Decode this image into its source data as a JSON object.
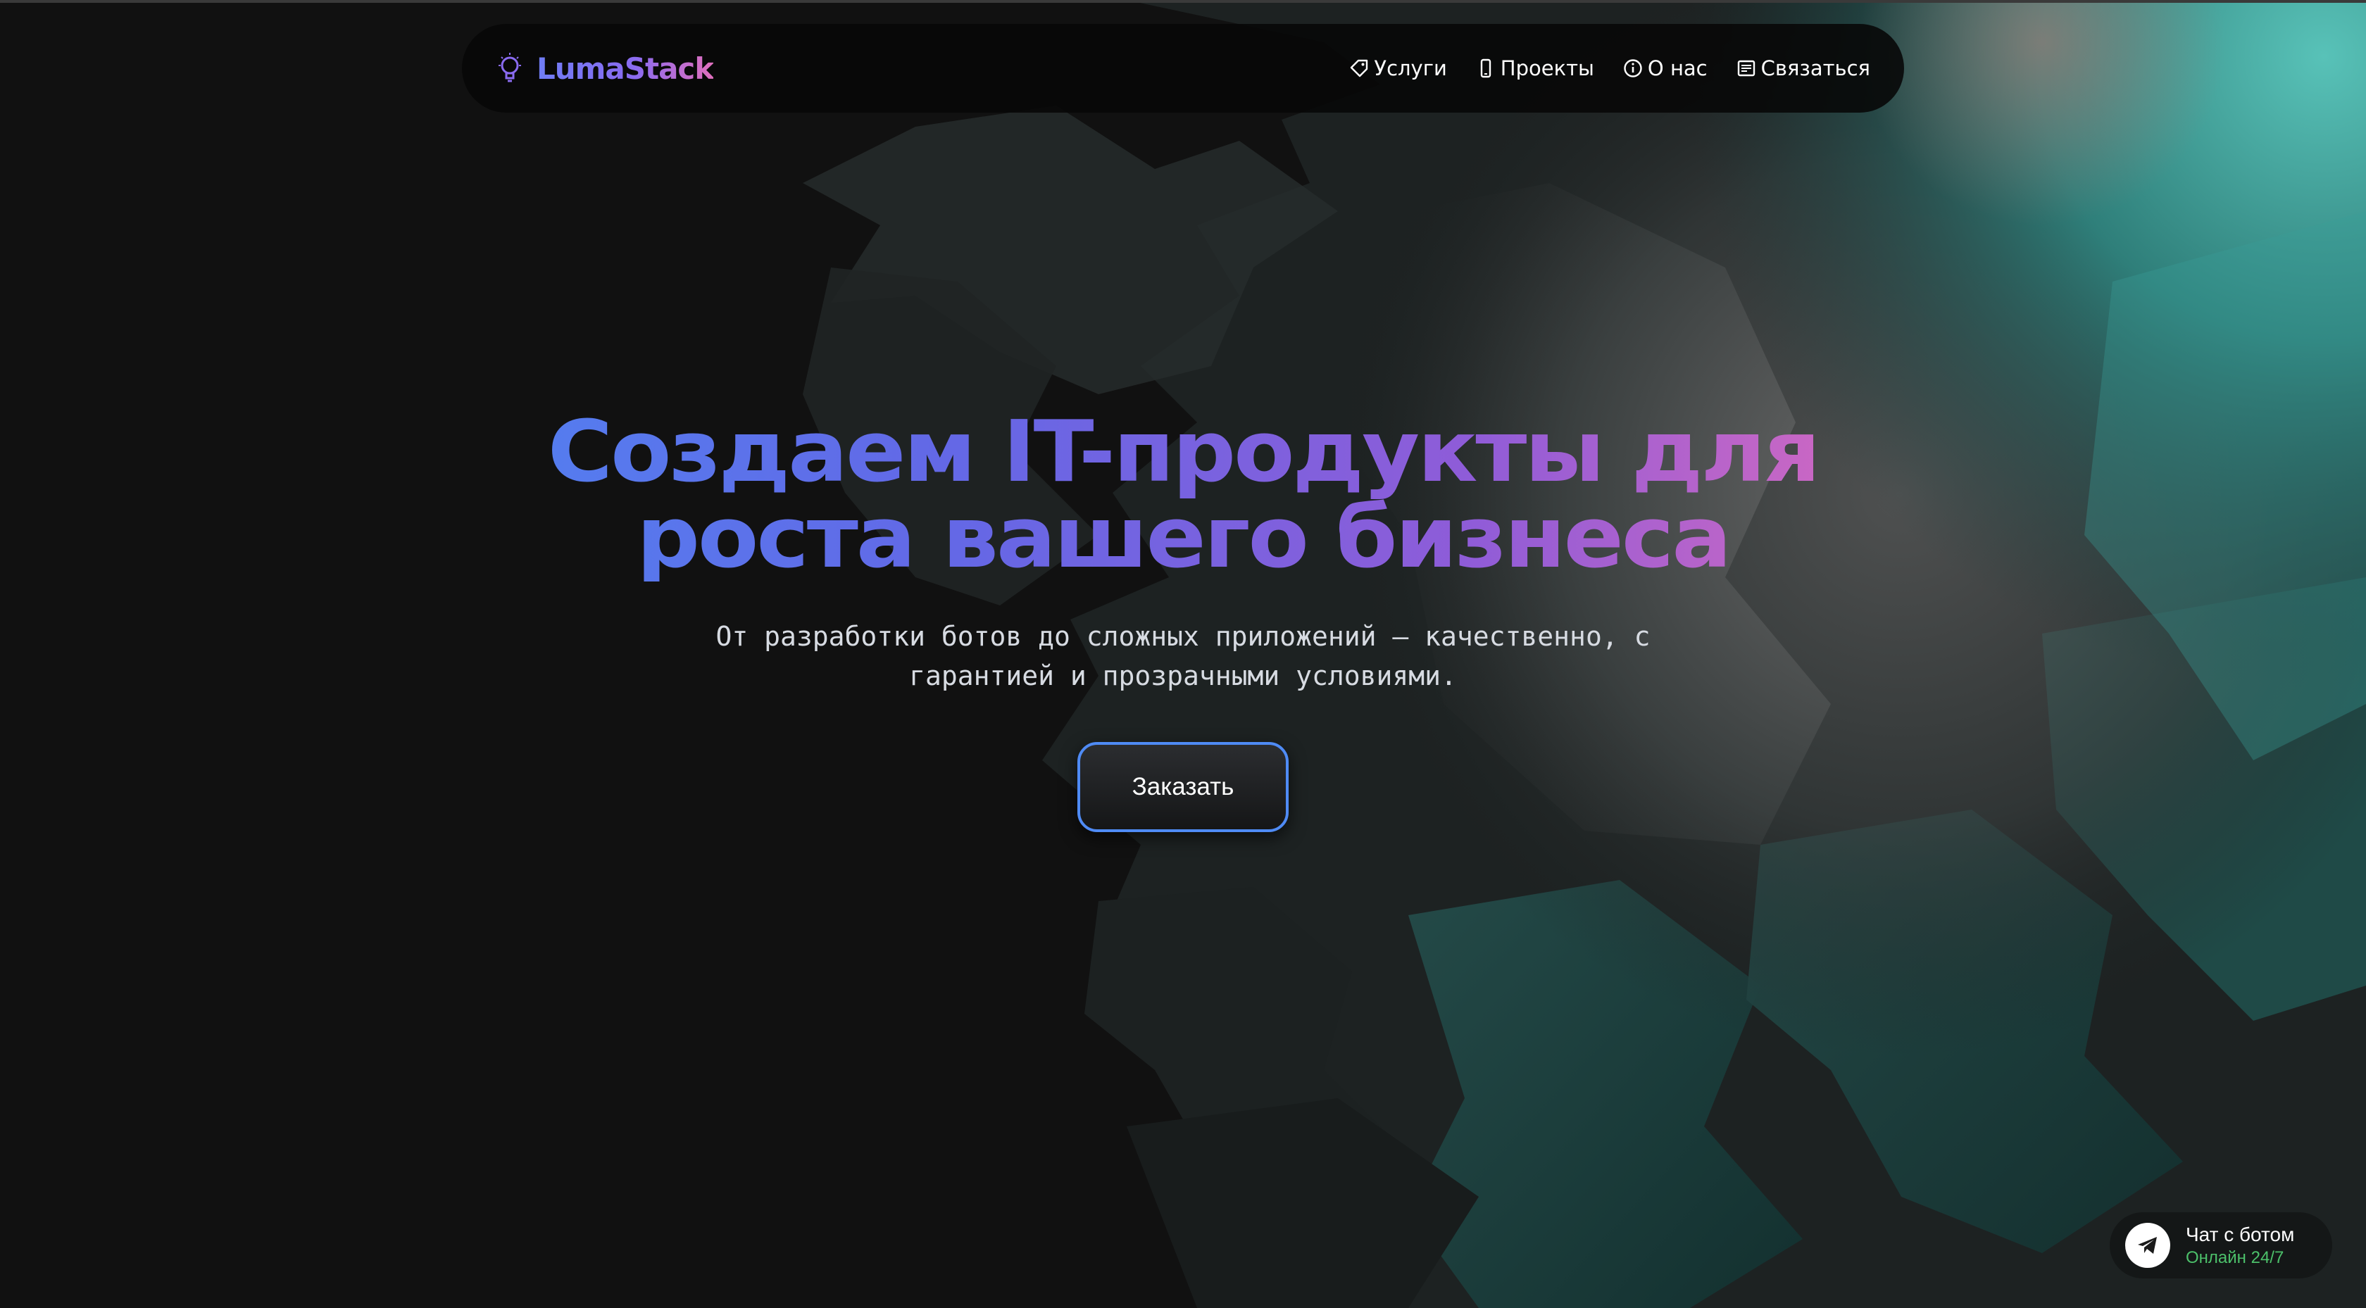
{
  "brand": {
    "name": "LumaStack",
    "logo_icon": "lightbulb-icon"
  },
  "nav": {
    "items": [
      {
        "label": "Услуги",
        "icon": "tag-icon"
      },
      {
        "label": "Проекты",
        "icon": "phone-icon"
      },
      {
        "label": "О нас",
        "icon": "info-icon"
      },
      {
        "label": "Связаться",
        "icon": "contact-form-icon"
      }
    ]
  },
  "hero": {
    "title_line1": "Создаем IT-продукты для",
    "title_line2": "роста вашего бизнеса",
    "subtitle_line1": "От разработки ботов до сложных приложений — качественно, с",
    "subtitle_line2": "гарантией и прозрачными условиями.",
    "cta_label": "Заказать"
  },
  "chat": {
    "title": "Чат с ботом",
    "status": "Онлайн 24/7",
    "icon": "telegram-icon"
  },
  "colors": {
    "background": "#111111",
    "gradient_blue": "#4f84f2",
    "gradient_purple": "#8f5cd8",
    "gradient_pink": "#e46cbb",
    "cta_border": "#4f8bf5",
    "online_green": "#4cc06a",
    "teal_accent": "#4fb9b1"
  }
}
